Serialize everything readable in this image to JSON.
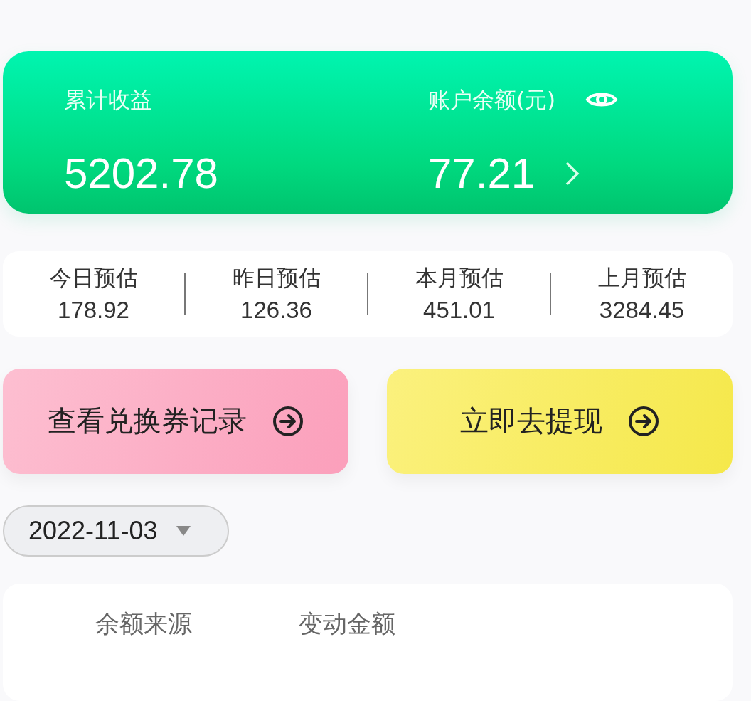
{
  "balance_card": {
    "total_label": "累计收益",
    "total_value": "5202.78",
    "balance_label": "账户余额(元)",
    "balance_value": "77.21"
  },
  "estimates": [
    {
      "label": "今日预估",
      "value": "178.92"
    },
    {
      "label": "昨日预估",
      "value": "126.36"
    },
    {
      "label": "本月预估",
      "value": "451.01"
    },
    {
      "label": "上月预估",
      "value": "3284.45"
    }
  ],
  "actions": [
    {
      "label": "查看兑换券记录",
      "kind": "pink"
    },
    {
      "label": "立即去提现",
      "kind": "yellow"
    }
  ],
  "date_picker": {
    "value": "2022-11-03"
  },
  "table": {
    "columns": [
      "余额来源",
      "变动金额"
    ]
  }
}
